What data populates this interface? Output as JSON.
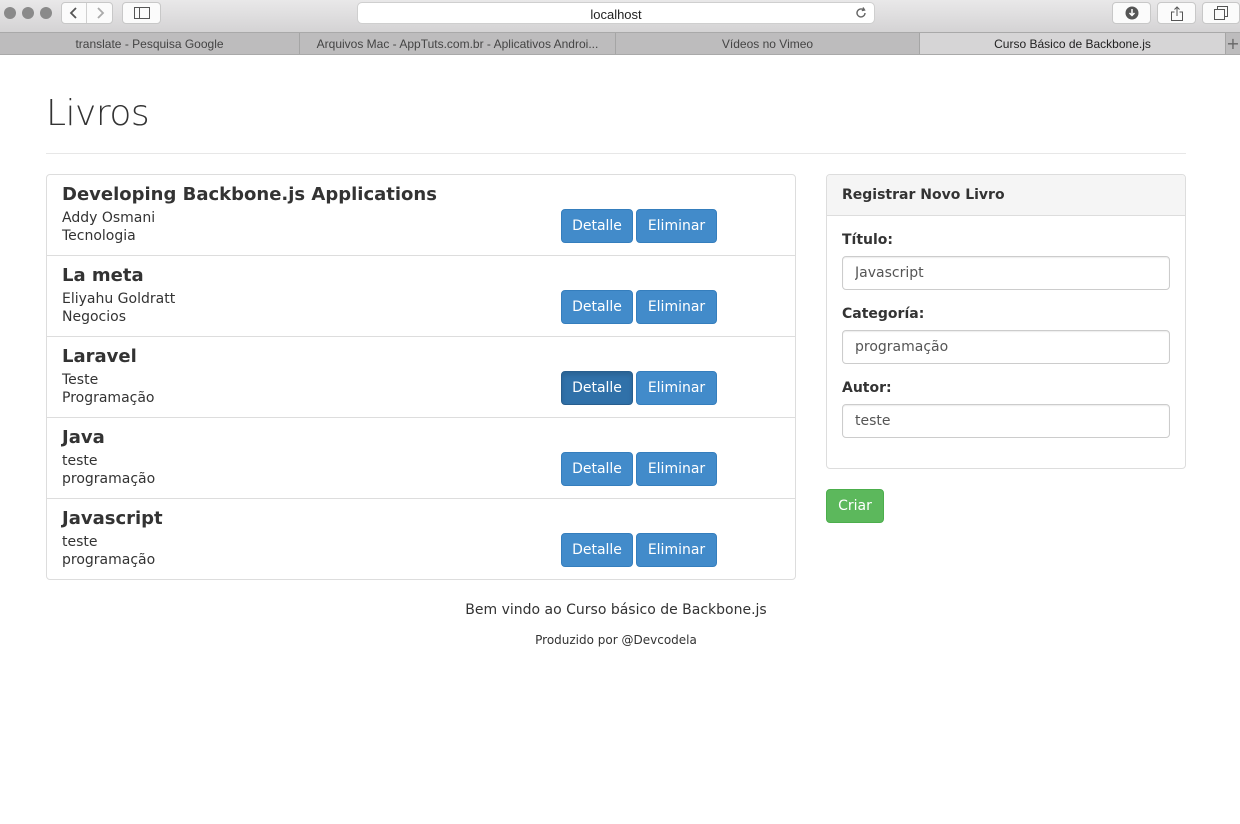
{
  "browser": {
    "url": "localhost",
    "tabs": [
      {
        "label": "translate - Pesquisa Google",
        "active": false
      },
      {
        "label": "Arquivos Mac - AppTuts.com.br - Aplicativos Androi...",
        "active": false
      },
      {
        "label": "Vídeos no Vimeo",
        "active": false
      },
      {
        "label": "Curso Básico de Backbone.js",
        "active": true
      }
    ],
    "new_tab": "+"
  },
  "page": {
    "title": "Livros"
  },
  "books": [
    {
      "title": "Developing Backbone.js Applications",
      "author": "Addy Osmani",
      "category": "Tecnologia"
    },
    {
      "title": "La meta",
      "author": "Eliyahu Goldratt",
      "category": "Negocios"
    },
    {
      "title": "Laravel",
      "author": "Teste",
      "category": "Programação"
    },
    {
      "title": "Java",
      "author": "teste",
      "category": "programação"
    },
    {
      "title": "Javascript",
      "author": "teste",
      "category": "programação"
    }
  ],
  "actions": {
    "detail_label": "Detalle",
    "delete_label": "Eliminar"
  },
  "form": {
    "heading": "Registrar Novo Livro",
    "title_label": "Título:",
    "title_value": "Javascript",
    "category_label": "Categoría:",
    "category_value": "programação",
    "author_label": "Autor:",
    "author_value": "teste",
    "submit_label": "Criar"
  },
  "footer": {
    "welcome": "Bem vindo ao Curso básico de Backbone.js",
    "credit": "Produzido por @Devcodela"
  },
  "colors": {
    "primary": "#428bca",
    "primary_pressed": "#3071a9",
    "success": "#5cb85c"
  }
}
